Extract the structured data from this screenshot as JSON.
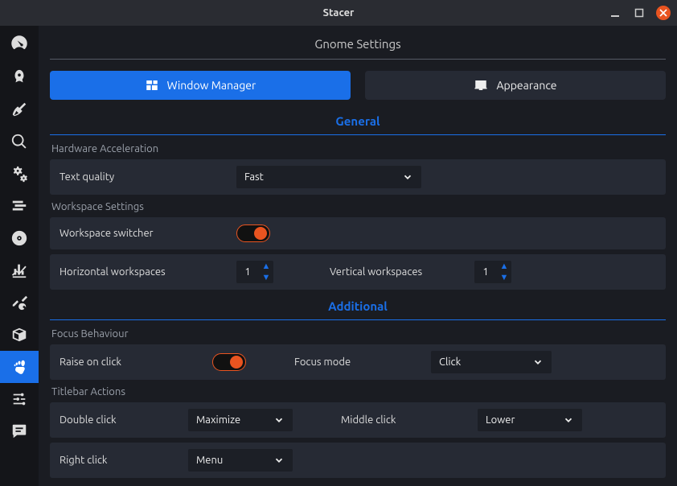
{
  "window": {
    "title": "Stacer"
  },
  "page": {
    "title": "Gnome Settings"
  },
  "tabs": {
    "window_manager": "Window Manager",
    "appearance": "Appearance"
  },
  "sections": {
    "general": "General",
    "additional": "Additional"
  },
  "hardware_accel": {
    "group": "Hardware Acceleration",
    "text_quality_label": "Text quality",
    "text_quality_value": "Fast"
  },
  "workspace": {
    "group": "Workspace Settings",
    "switcher_label": "Workspace switcher",
    "switcher_on": true,
    "horizontal_label": "Horizontal workspaces",
    "horizontal_value": "1",
    "vertical_label": "Vertical workspaces",
    "vertical_value": "1"
  },
  "focus": {
    "group": "Focus Behaviour",
    "raise_label": "Raise on click",
    "raise_on": true,
    "mode_label": "Focus mode",
    "mode_value": "Click"
  },
  "titlebar": {
    "group": "Titlebar Actions",
    "double_label": "Double click",
    "double_value": "Maximize",
    "middle_label": "Middle click",
    "middle_value": "Lower",
    "right_label": "Right click",
    "right_value": "Menu"
  }
}
